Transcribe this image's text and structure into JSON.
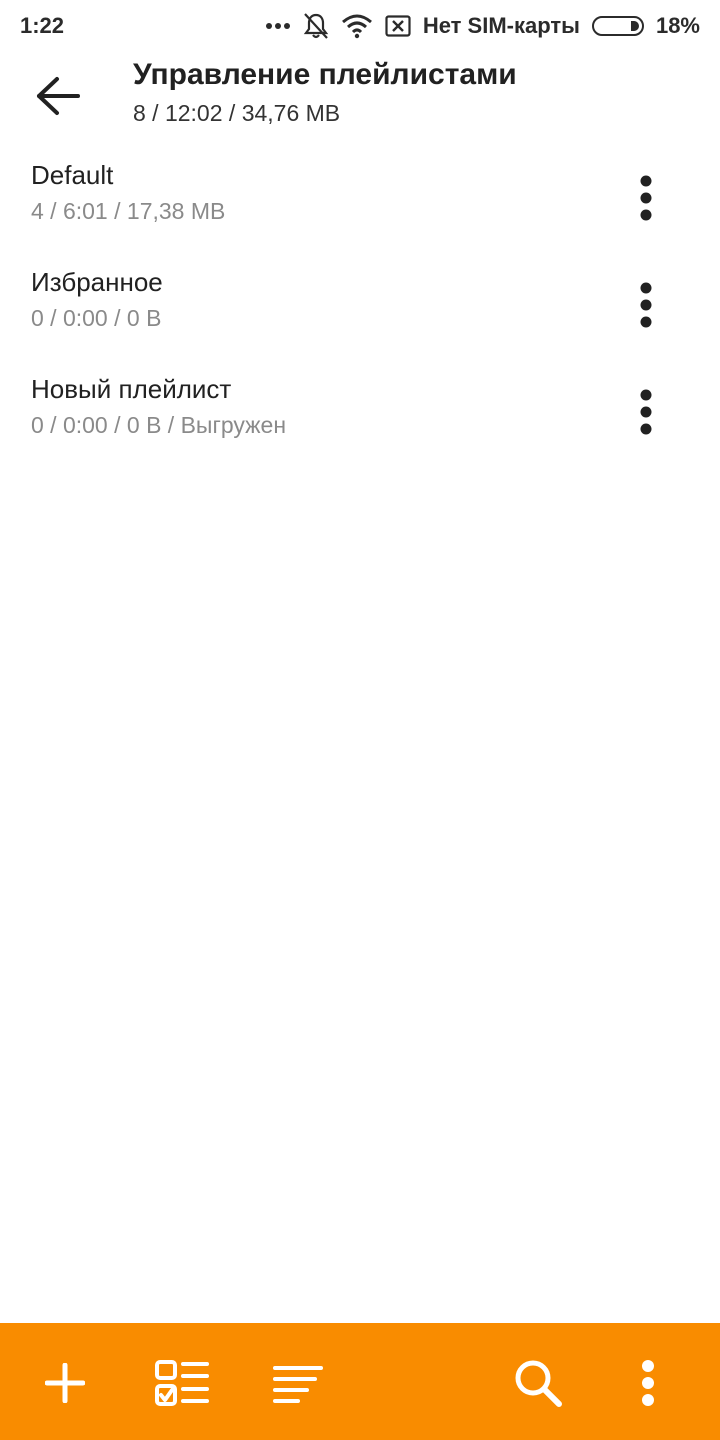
{
  "status_bar": {
    "time": "1:22",
    "carrier": "Нет SIM-карты",
    "battery_text": "18%",
    "battery_level": 0.18,
    "icons": [
      "more-dots-icon",
      "bell-off-icon",
      "wifi-icon",
      "sim-x-icon",
      "battery-icon"
    ]
  },
  "header": {
    "back_icon": "arrow-left-icon",
    "title": "Управление плейлистами",
    "subtitle": "8 / 12:02 / 34,76 MB"
  },
  "playlists": [
    {
      "name": "Default",
      "details": "4 / 6:01 / 17,38 MB",
      "menu_icon": "more-vertical-icon"
    },
    {
      "name": "Избранное",
      "details": "0 / 0:00 / 0 B",
      "menu_icon": "more-vertical-icon"
    },
    {
      "name": "Новый плейлист",
      "details": "0 / 0:00 / 0 B / Выгружен",
      "menu_icon": "more-vertical-icon"
    }
  ],
  "toolbar": {
    "background_color": "#F98C00",
    "icon_color": "#FFFFFF",
    "buttons": [
      "plus-icon",
      "checklist-icon",
      "sort-lines-icon",
      "search-icon",
      "more-vertical-icon"
    ]
  }
}
